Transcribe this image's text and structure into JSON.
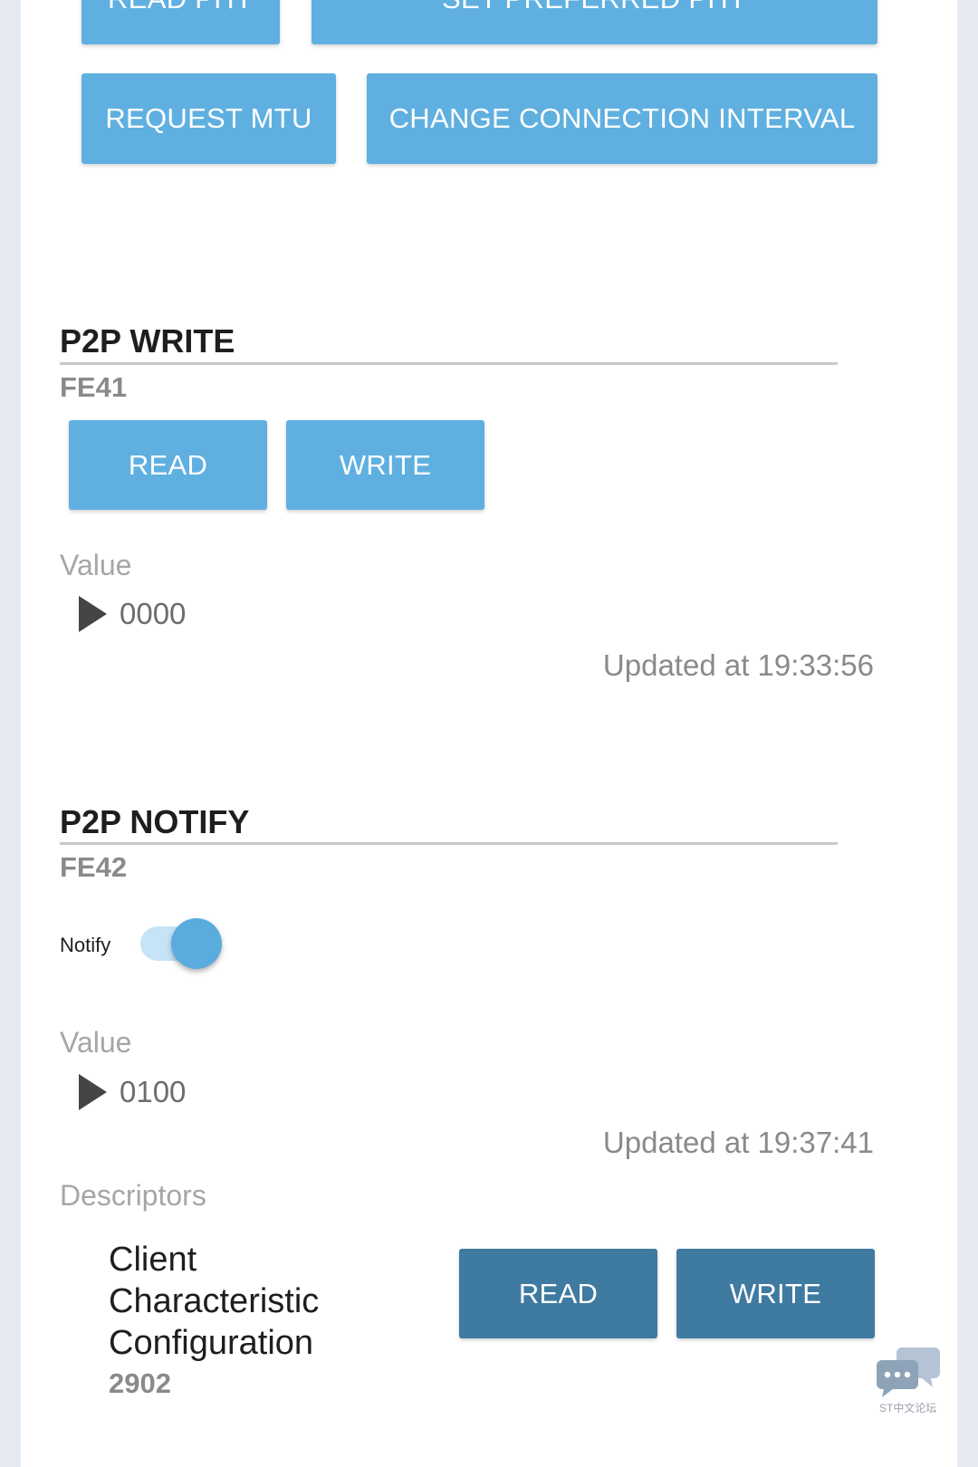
{
  "toolbar": {
    "read_phy": "READ PHY",
    "set_preferred_phy": "SET PREFERRED PHY",
    "request_mtu": "REQUEST MTU",
    "change_connection_interval": "CHANGE CONNECTION INTERVAL"
  },
  "p2p_write": {
    "title": "P2P WRITE",
    "uuid": "FE41",
    "read_label": "READ",
    "write_label": "WRITE",
    "value_label": "Value",
    "value": "0000",
    "updated": "Updated at 19:33:56"
  },
  "p2p_notify": {
    "title": "P2P NOTIFY",
    "uuid": "FE42",
    "notify_label": "Notify",
    "notify_on": true,
    "value_label": "Value",
    "value": "0100",
    "updated": "Updated at 19:37:41",
    "descriptors_label": "Descriptors",
    "descriptor": {
      "name_line1": "Client",
      "name_line2": "Characteristic",
      "name_line3": "Configuration",
      "uuid": "2902",
      "read_label": "READ",
      "write_label": "WRITE"
    }
  },
  "watermark": {
    "text": "ST中文论坛"
  },
  "colors": {
    "button": "#5fb0e0",
    "button_dark": "#3f7aa1",
    "toggle_track": "#c6e4f6",
    "toggle_knob": "#5aabde"
  },
  "icons": {
    "expand": "play-triangle-icon",
    "forum": "chat-bubbles-icon"
  }
}
